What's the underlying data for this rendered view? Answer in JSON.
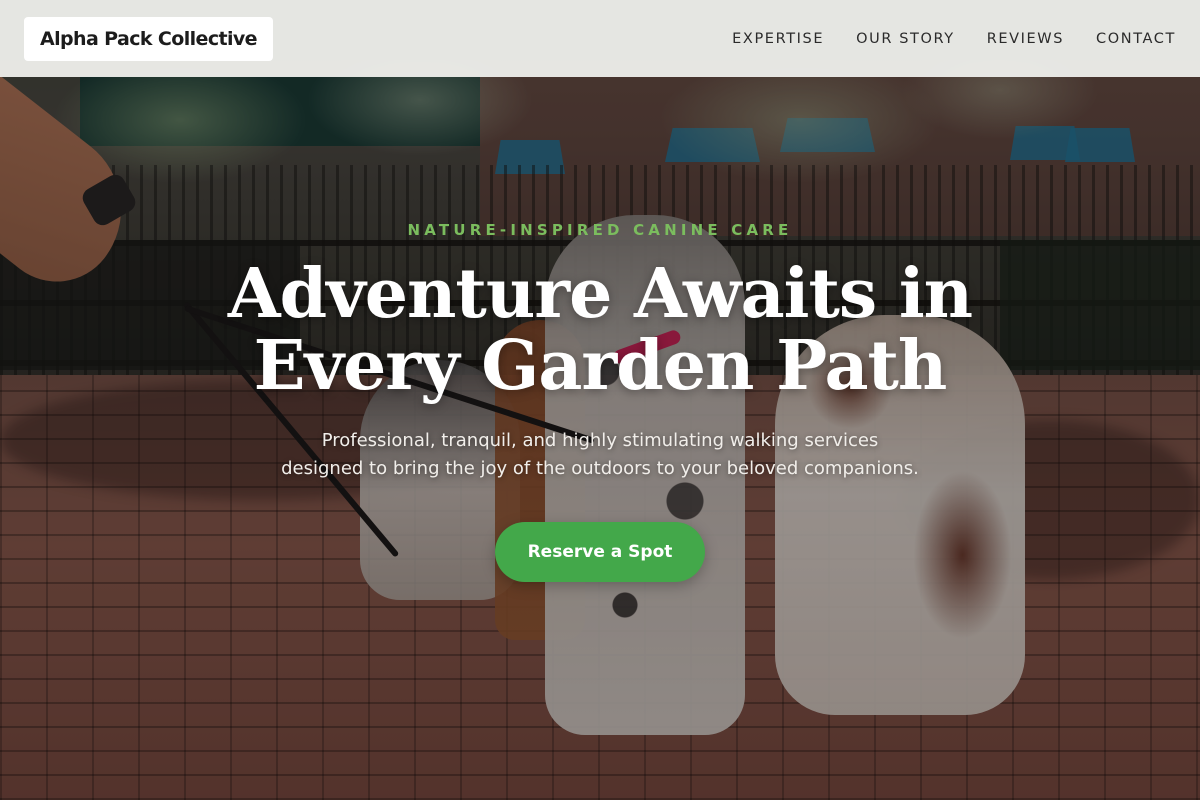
{
  "header": {
    "logo_text": "Alpha Pack Collective",
    "nav": [
      {
        "label": "EXPERTISE"
      },
      {
        "label": "OUR STORY"
      },
      {
        "label": "REVIEWS"
      },
      {
        "label": "CONTACT"
      }
    ]
  },
  "hero": {
    "eyebrow": "NATURE-INSPIRED CANINE CARE",
    "headline_line1": "Adventure Awaits in",
    "headline_line2": "Every Garden Path",
    "subtitle_line1": "Professional, tranquil, and highly stimulating walking services",
    "subtitle_line2": "designed to bring the joy of the outdoors to your beloved companions.",
    "cta_label": "Reserve a Spot"
  },
  "colors": {
    "accent_green": "#43a84a",
    "eyebrow_green": "#7bbd5e",
    "header_bg": "#f5f5f2"
  }
}
